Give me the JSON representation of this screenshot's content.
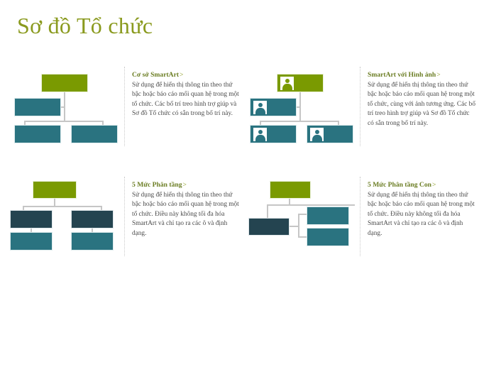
{
  "page": {
    "title": "Sơ đồ Tổ chức",
    "title_color": "#8a9a1e",
    "background": "#ffffff"
  },
  "palette": {
    "olive": "#7a9a01",
    "teal": "#2a7380",
    "navy": "#244450",
    "connector": "#c6c6c6",
    "heading": "#6b7d23",
    "body_text": "#4a4a4a",
    "divider": "#c9c9c9"
  },
  "layouts": [
    {
      "id": "co-so-smartart",
      "title": "Cơ sở SmartArt",
      "chevron": ">",
      "description": "Sử dụng để hiển thị thông tin theo thứ bậc hoặc báo cáo mối quan hệ trong một tổ chức. Các bố trí treo hình trợ giúp và Sơ đồ Tổ chức có sẵn trong bố trí này.",
      "has_pictures": false
    },
    {
      "id": "smartart-voi-hinh-anh",
      "title": "SmartArt với Hình ảnh",
      "chevron": ">",
      "description": "Sử dụng để hiển thị thông tin theo thứ bậc hoặc báo cáo mối quan hệ trong một tổ chức, cùng với ảnh tương ứng. Các bố trí treo hình trợ giúp và Sơ đồ Tổ chức có sẵn trong bố trí này.",
      "has_pictures": true
    },
    {
      "id": "5-muc-phan-tang",
      "title": "5 Mức Phân tầng",
      "chevron": ">",
      "description": "Sử dụng để hiển thị thông tin theo thứ bậc hoặc báo cáo mối quan hệ trong một tổ chức. Điều này không tối đa hóa SmartArt và chỉ tạo ra các ô và định dạng.",
      "has_pictures": false
    },
    {
      "id": "5-muc-phan-tang-con",
      "title": "5 Mức Phân tầng Con",
      "chevron": ">",
      "description": "Sử dụng để hiển thị thông tin theo thứ bậc hoặc báo cáo mối quan hệ trong một tổ chức. Điều này không tối đa hóa SmartArt và chỉ tạo ra các ô và định dạng.",
      "has_pictures": false
    }
  ],
  "icons": {
    "person": "person-icon",
    "chevron": "chevron-right"
  }
}
